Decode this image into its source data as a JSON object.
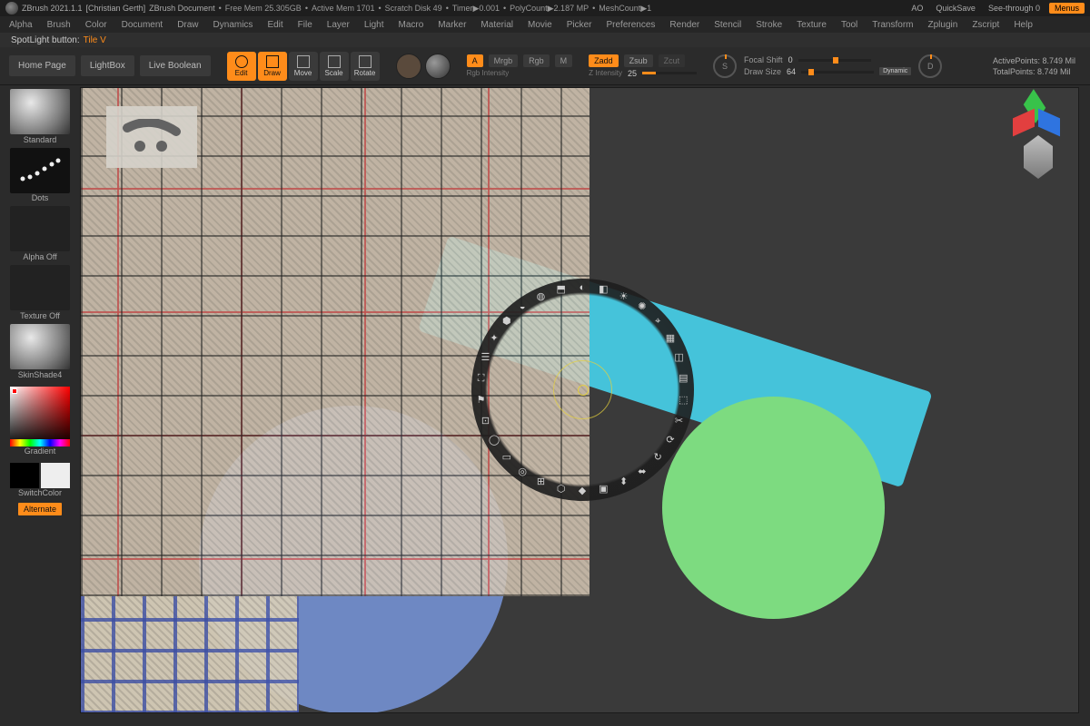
{
  "titlebar": {
    "app": "ZBrush 2021.1.1",
    "user": "[Christian Gerth]",
    "doc": "ZBrush Document",
    "free_mem": "Free Mem 25.305GB",
    "active_mem": "Active Mem 1701",
    "scratch": "Scratch Disk 49",
    "timer": "Timer▶0.001",
    "polycount": "PolyCount▶2.187 MP",
    "meshcount": "MeshCount▶1",
    "ao": "AO",
    "quicksave": "QuickSave",
    "seethrough": "See-through  0",
    "menus": "Menus"
  },
  "menubar": [
    "Alpha",
    "Brush",
    "Color",
    "Document",
    "Draw",
    "Dynamics",
    "Edit",
    "File",
    "Layer",
    "Light",
    "Macro",
    "Marker",
    "Material",
    "Movie",
    "Picker",
    "Preferences",
    "Render",
    "Stencil",
    "Stroke",
    "Texture",
    "Tool",
    "Transform",
    "Zplugin",
    "Zscript",
    "Help"
  ],
  "hint": {
    "label": "SpotLight button:",
    "value": "Tile V"
  },
  "toolrow": {
    "nav": [
      "Home Page",
      "LightBox",
      "Live Boolean"
    ],
    "modes": [
      {
        "label": "Edit",
        "active": true
      },
      {
        "label": "Draw",
        "active": true
      },
      {
        "label": "Move",
        "active": false
      },
      {
        "label": "Scale",
        "active": false
      },
      {
        "label": "Rotate",
        "active": false
      }
    ],
    "rgb": {
      "A": "A",
      "mrgb": "Mrgb",
      "rgb": "Rgb",
      "m": "M",
      "sub": "Rgb Intensity"
    },
    "z": {
      "zadd": "Zadd",
      "zsub": "Zsub",
      "zcut": "Zcut",
      "intensity_label": "Z Intensity",
      "intensity_val": "25"
    },
    "focal": {
      "shift_label": "Focal Shift",
      "shift_val": "0",
      "draw_label": "Draw Size",
      "draw_val": "64",
      "dynamic": "Dynamic",
      "S": "S",
      "D": "D"
    },
    "points": {
      "active": "ActivePoints: 8.749 Mil",
      "total": "TotalPoints: 8.749 Mil"
    }
  },
  "shelf": {
    "brush": "Standard",
    "stroke": "Dots",
    "alpha": "Alpha Off",
    "texture": "Texture Off",
    "material": "SkinShade4",
    "gradient": "Gradient",
    "switch": "SwitchColor",
    "alternate": "Alternate"
  },
  "colors": {
    "main": "#ff3020",
    "secondary_black": "#000000",
    "secondary_white": "#ffffff"
  }
}
